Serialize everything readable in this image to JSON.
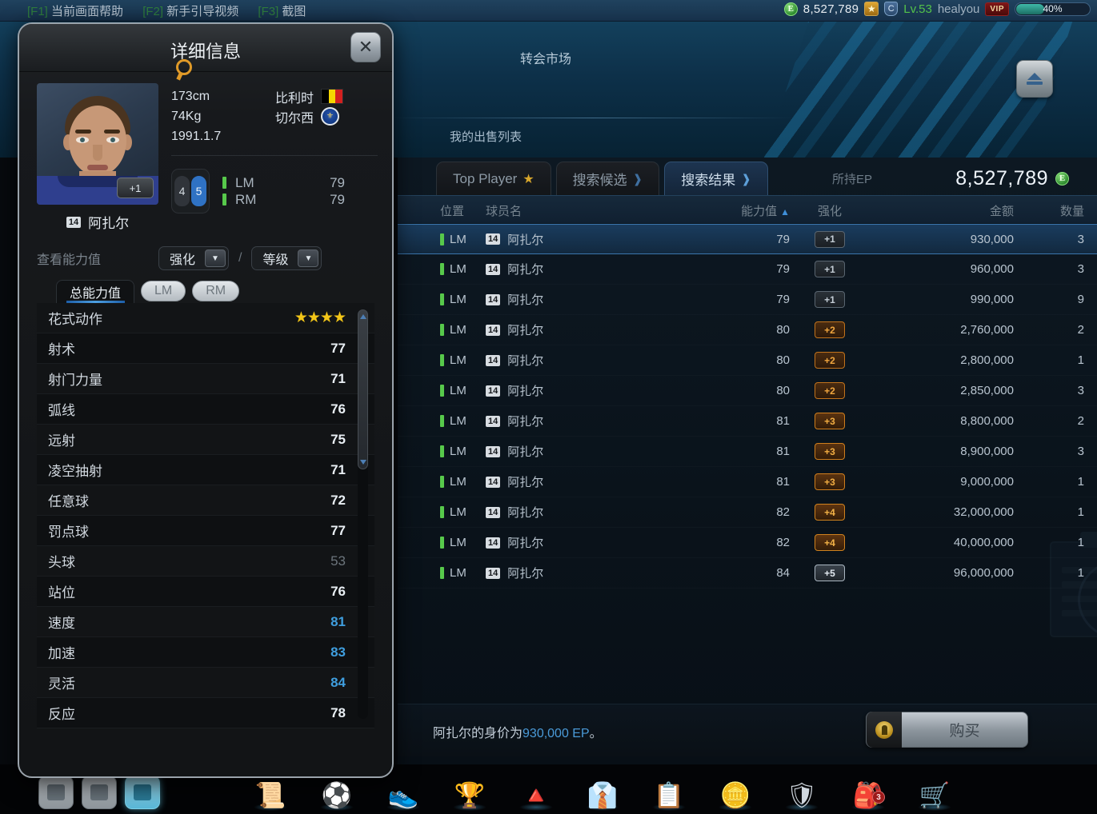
{
  "topbar": {
    "hotkeys": [
      {
        "key": "[F1]",
        "label": "当前画面帮助"
      },
      {
        "key": "[F2]",
        "label": "新手引导视频"
      },
      {
        "key": "[F3]",
        "label": "截图"
      }
    ],
    "currency_symbol": "E",
    "currency_amount": "8,527,789",
    "level": "Lv.53",
    "username": "healyou",
    "vip_badge": "VIP",
    "exp_percent": "40%"
  },
  "background": {
    "market_title": "转会市场",
    "my_sales_list": "我的出售列表",
    "eject_button": "eject"
  },
  "market": {
    "tabs": [
      {
        "label": "Top Player",
        "icon": "star-icon",
        "active": false
      },
      {
        "label": "搜索候选",
        "icon": "chevron-right-icon",
        "active": false
      },
      {
        "label": "搜索结果",
        "icon": "chevron-right-icon",
        "active": true
      }
    ],
    "ep_label": "所持EP",
    "ep_value": "8,527,789",
    "columns": {
      "position": "位置",
      "player_name": "球员名",
      "overall": "能力值",
      "sort_indicator": "▲",
      "enhance": "强化",
      "price": "金额",
      "quantity": "数量"
    },
    "rows": [
      {
        "position": "LM",
        "number": "14",
        "name": "阿扎尔",
        "overall": "79",
        "enhance": "+1",
        "enhance_tier": 1,
        "price": "930,000",
        "qty": "3",
        "selected": true
      },
      {
        "position": "LM",
        "number": "14",
        "name": "阿扎尔",
        "overall": "79",
        "enhance": "+1",
        "enhance_tier": 1,
        "price": "960,000",
        "qty": "3",
        "selected": false
      },
      {
        "position": "LM",
        "number": "14",
        "name": "阿扎尔",
        "overall": "79",
        "enhance": "+1",
        "enhance_tier": 1,
        "price": "990,000",
        "qty": "9",
        "selected": false
      },
      {
        "position": "LM",
        "number": "14",
        "name": "阿扎尔",
        "overall": "80",
        "enhance": "+2",
        "enhance_tier": 2,
        "price": "2,760,000",
        "qty": "2",
        "selected": false
      },
      {
        "position": "LM",
        "number": "14",
        "name": "阿扎尔",
        "overall": "80",
        "enhance": "+2",
        "enhance_tier": 2,
        "price": "2,800,000",
        "qty": "1",
        "selected": false
      },
      {
        "position": "LM",
        "number": "14",
        "name": "阿扎尔",
        "overall": "80",
        "enhance": "+2",
        "enhance_tier": 2,
        "price": "2,850,000",
        "qty": "3",
        "selected": false
      },
      {
        "position": "LM",
        "number": "14",
        "name": "阿扎尔",
        "overall": "81",
        "enhance": "+3",
        "enhance_tier": 3,
        "price": "8,800,000",
        "qty": "2",
        "selected": false
      },
      {
        "position": "LM",
        "number": "14",
        "name": "阿扎尔",
        "overall": "81",
        "enhance": "+3",
        "enhance_tier": 3,
        "price": "8,900,000",
        "qty": "3",
        "selected": false
      },
      {
        "position": "LM",
        "number": "14",
        "name": "阿扎尔",
        "overall": "81",
        "enhance": "+3",
        "enhance_tier": 3,
        "price": "9,000,000",
        "qty": "1",
        "selected": false
      },
      {
        "position": "LM",
        "number": "14",
        "name": "阿扎尔",
        "overall": "82",
        "enhance": "+4",
        "enhance_tier": 4,
        "price": "32,000,000",
        "qty": "1",
        "selected": false
      },
      {
        "position": "LM",
        "number": "14",
        "name": "阿扎尔",
        "overall": "82",
        "enhance": "+4",
        "enhance_tier": 4,
        "price": "40,000,000",
        "qty": "1",
        "selected": false
      },
      {
        "position": "LM",
        "number": "14",
        "name": "阿扎尔",
        "overall": "84",
        "enhance": "+5",
        "enhance_tier": 5,
        "price": "96,000,000",
        "qty": "1",
        "selected": false
      }
    ],
    "buy_message_prefix": "阿扎尔的身价为",
    "buy_message_price": "930,000 EP",
    "buy_message_suffix": "。",
    "buy_button": "购买"
  },
  "dialog": {
    "title": "详细信息",
    "close_label": "✕",
    "player": {
      "number": "14",
      "name": "阿扎尔",
      "plus_badge": "+1",
      "height": "173cm",
      "weight": "74Kg",
      "birthdate": "1991.1.7",
      "nationality": "比利时",
      "club": "切尔西",
      "club_crest_text": "CFC",
      "weak_foot": "4",
      "strong_foot": "5",
      "positions": [
        {
          "code": "LM",
          "value": "79"
        },
        {
          "code": "RM",
          "value": "79"
        }
      ]
    },
    "view_label": "查看能力值",
    "dropdown_enhance": "强化",
    "dropdown_separator": "/",
    "dropdown_level": "等级",
    "stat_tabs": [
      {
        "label": "总能力值",
        "active": true
      },
      {
        "label": "LM",
        "active": false
      },
      {
        "label": "RM",
        "active": false
      }
    ],
    "stats": [
      {
        "label": "花式动作",
        "value": "★★★★",
        "style": "stars"
      },
      {
        "label": "射术",
        "value": "77",
        "style": "normal"
      },
      {
        "label": "射门力量",
        "value": "71",
        "style": "normal"
      },
      {
        "label": "弧线",
        "value": "76",
        "style": "normal"
      },
      {
        "label": "远射",
        "value": "75",
        "style": "normal"
      },
      {
        "label": "凌空抽射",
        "value": "71",
        "style": "normal"
      },
      {
        "label": "任意球",
        "value": "72",
        "style": "normal"
      },
      {
        "label": "罚点球",
        "value": "77",
        "style": "normal"
      },
      {
        "label": "头球",
        "value": "53",
        "style": "dim"
      },
      {
        "label": "站位",
        "value": "76",
        "style": "normal"
      },
      {
        "label": "速度",
        "value": "81",
        "style": "blue"
      },
      {
        "label": "加速",
        "value": "83",
        "style": "blue"
      },
      {
        "label": "灵活",
        "value": "84",
        "style": "blue"
      },
      {
        "label": "反应",
        "value": "78",
        "style": "normal"
      }
    ]
  },
  "dock": {
    "app_icons": [
      {
        "name": "home-icon",
        "active": false
      },
      {
        "name": "chat-icon",
        "active": false
      },
      {
        "name": "gallery-icon",
        "active": true
      }
    ],
    "items": [
      {
        "name": "contract-icon",
        "glyph": "📜"
      },
      {
        "name": "ball-icon",
        "glyph": "⚽"
      },
      {
        "name": "boot-icon",
        "glyph": "👟"
      },
      {
        "name": "trophy-icon",
        "glyph": "🏆"
      },
      {
        "name": "ranking-pyramid-icon",
        "glyph": "🔺"
      },
      {
        "name": "uniform-icon",
        "glyph": "👔"
      },
      {
        "name": "clipboard-icon",
        "glyph": "📋"
      },
      {
        "name": "coin-icon",
        "glyph": "🪙"
      },
      {
        "name": "club-icon",
        "glyph": "🛡"
      },
      {
        "name": "bag-icon",
        "glyph": "🎒",
        "badge": "3"
      },
      {
        "name": "cart-icon",
        "glyph": "🛒"
      }
    ]
  },
  "colors": {
    "accent_blue": "#3f9ede",
    "position_green": "#57c94b",
    "enhance_orange": "#f0a63f",
    "star_yellow": "#f2c518"
  }
}
